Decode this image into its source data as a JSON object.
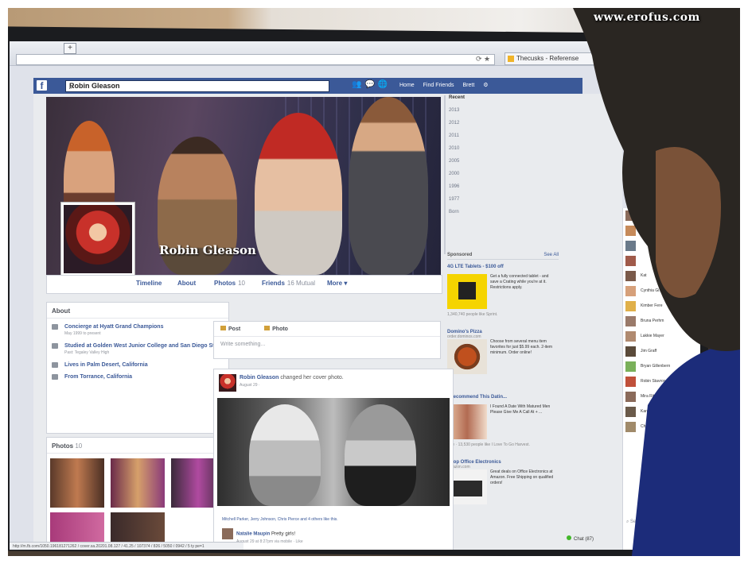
{
  "watermark": "www.erofus.com",
  "browser": {
    "tab_title": "Thecusks - Referense",
    "new_tab_label": "+"
  },
  "fb": {
    "logo": "f",
    "search_value": "Robin Gleason",
    "nav": [
      "Home",
      "Find Friends",
      "Brett"
    ],
    "brand_color": "#3b5998"
  },
  "profile": {
    "name": "Robin Gleason",
    "tabs": {
      "timeline": "Timeline",
      "about": "About",
      "photos": "Photos",
      "photos_count": "10",
      "friends": "Friends",
      "friends_count": "16 Mutual",
      "more": "More ▾"
    }
  },
  "years": [
    "Recent",
    "2013",
    "2012",
    "2011",
    "2010",
    "2005",
    "2000",
    "1996",
    "1977",
    "Born"
  ],
  "sponsored": {
    "title": "Sponsored",
    "see_all": "See All",
    "ads": [
      {
        "title": "4G LTE Tablets - $100 off",
        "domain": "",
        "text": "Get a fully connected tablet - and save a Crating while you're at it. Restrictions apply.",
        "like": "1,340,740 people like Sprint."
      },
      {
        "title": "Domino's Pizza",
        "domain": "order.dominos.com",
        "text": "Choose from several menu item favorites for just $5.99 each. 2-item minimum. Order online!",
        "like": ""
      },
      {
        "title": "I Recommend This Datin...",
        "domain": "",
        "text": "I Found A Date With Matured Men Please Give Me A Call At + ...",
        "like": "Like · 13,530 people like I Love To Go Harvest."
      },
      {
        "title": "Shop Office Electronics",
        "domain": "amazon.com",
        "text": "Great deals on Office Electronics at Amazon. Free Shipping on qualified orders!",
        "like": ""
      }
    ]
  },
  "about": {
    "title": "About",
    "items": [
      {
        "text": "Concierge at Hyatt Grand Champions",
        "sub": "May 1999 to present"
      },
      {
        "text": "Studied at Golden West Junior College and San Diego State",
        "sub": "Past: Tegaley Valley High"
      },
      {
        "text": "Lives in Palm Desert, California",
        "sub": ""
      },
      {
        "text": "From Torrance, California",
        "sub": ""
      }
    ]
  },
  "photos": {
    "title": "Photos",
    "count": "10"
  },
  "composer": {
    "post_label": "Post",
    "photo_label": "Photo",
    "placeholder": "Write something..."
  },
  "post": {
    "author": "Robin Gleason",
    "action": "changed her cover photo.",
    "date": "August 29 ·",
    "likes": "Mitchell Parker, Jerry Johnson, Chris Pierce and 4 others like this.",
    "commenter": "Natalie Maupin",
    "comment": "Pretty girls!",
    "comment_meta": "August 29 at 8:27pm via mobile · Like"
  },
  "chat": {
    "contacts": [
      "",
      "",
      "",
      "",
      "Kat",
      "Cynthia Gi...",
      "Kimber Fere",
      "Bruna Perhm",
      "Lakkie Mayer",
      "Jim Graff",
      "Bryan Gillenbern",
      "Robin Stavros Cope",
      "Mira Ritchel",
      "Karen Scott",
      "Charles Fisher"
    ],
    "search_label": "Search",
    "status": "Chat (87)"
  },
  "status_bar": "http://m.fb.com/1050.196181271262 / cover.sa.20201.08.127 / 41.25 / 107374 / 826 / 5050 / 0942 / 5 ty pe=1"
}
